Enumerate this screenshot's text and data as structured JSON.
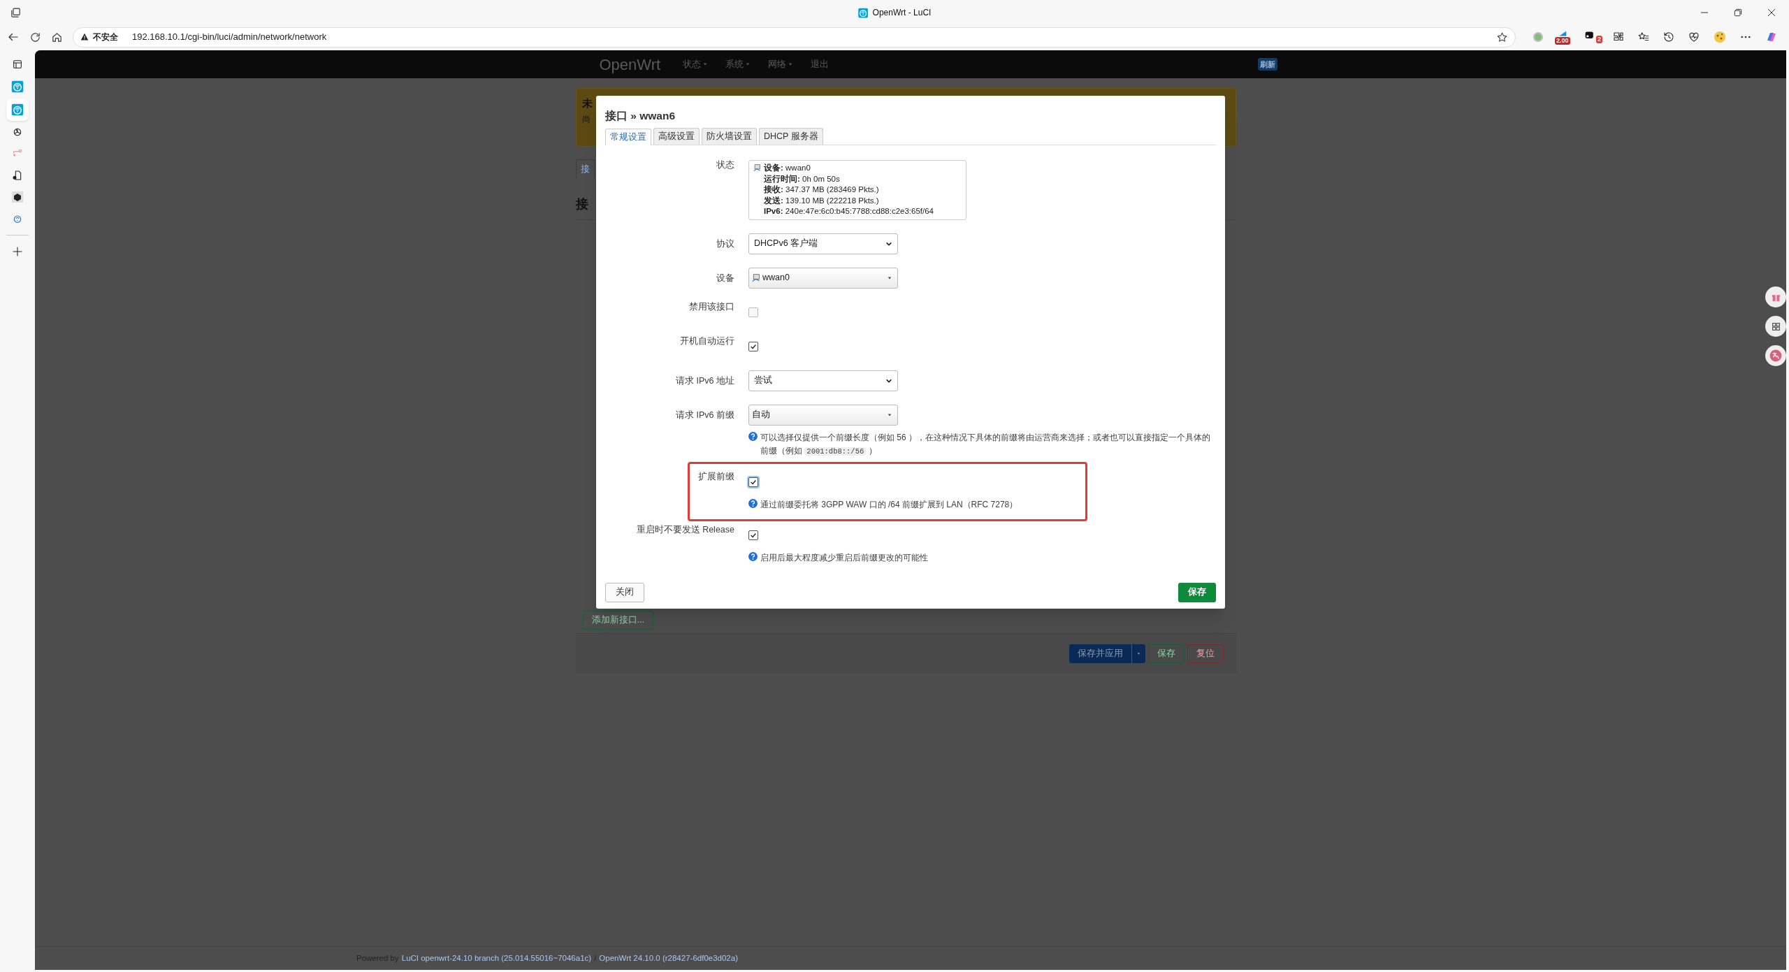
{
  "browser": {
    "tab_title": "OpenWrt - LuCI",
    "security": "不安全",
    "url": "192.168.10.1/cgi-bin/luci/admin/network/network",
    "extension_badges": [
      "2.00",
      "2"
    ]
  },
  "navbar": {
    "brand": "OpenWrt",
    "menu": [
      {
        "label": "状态",
        "dropdown": true
      },
      {
        "label": "系统",
        "dropdown": true
      },
      {
        "label": "网络",
        "dropdown": true
      },
      {
        "label": "退出",
        "dropdown": false
      }
    ],
    "badge": "刷新"
  },
  "background": {
    "alert_title": "未",
    "alert_text": "尚",
    "tab": "接",
    "heading": "接",
    "add_button": "添加新接口...",
    "actions": [
      {
        "label": "保存并应用",
        "kind": "split"
      },
      {
        "label": "保存",
        "kind": "success"
      },
      {
        "label": "复位",
        "kind": "danger"
      }
    ]
  },
  "footer": {
    "prefix": "Powered by",
    "luci": "LuCI openwrt-24.10 branch (25.014.55016~7046a1c)",
    "separator": "/",
    "openwrt": "OpenWrt 24.10.0 (r28427-6df0e3d02a)"
  },
  "dialog": {
    "title": "接口 » wwan6",
    "tabs": [
      {
        "label": "常规设置",
        "selected": true
      },
      {
        "label": "高级设置",
        "selected": false
      },
      {
        "label": "防火墙设置",
        "selected": false
      },
      {
        "label": "DHCP 服务器",
        "selected": false
      }
    ],
    "fields": [
      {
        "kind": "status",
        "label": "状态",
        "lines": [
          "**设备:** wwan0",
          "**运行时间:** 0h 0m 50s",
          "**接收:** 347.37 MB (283469 Pkts.)",
          "**发送:** 139.10 MB (222218 Pkts.)",
          "**IPv6:** 240e:47e:6c0:b45:7788:cd88:c2e3:65f/64"
        ]
      },
      {
        "kind": "select",
        "label": "协议",
        "value": "DHCPv6 客户端"
      },
      {
        "kind": "dropdown",
        "label": "设备",
        "value": "wwan0",
        "device_icon": true
      },
      {
        "kind": "checkbox",
        "label": "禁用该接口",
        "checked": false
      },
      {
        "kind": "checkbox",
        "label": "开机自动运行",
        "checked": true
      },
      {
        "kind": "select",
        "label": "请求 IPv6 地址",
        "value": "尝试"
      },
      {
        "kind": "dropdown",
        "label": "请求 IPv6 前缀",
        "value": "自动",
        "help": "可以选择仅提供一个前缀长度（例如 56 ），在这种情况下具体的前缀将由运营商来选择；或者也可以直接指定一个具体的前缀（例如 ",
        "help_code": "2001:db8::/56",
        "help_suffix": " ）"
      },
      {
        "kind": "checkbox",
        "label": "扩展前缀",
        "checked": true,
        "focused": true,
        "highlighted": true,
        "help": "通过前缀委托将 3GPP WAW 口的 /64 前缀扩展到 LAN（RFC 7278）"
      },
      {
        "kind": "checkbox",
        "label": "重启时不要发送 Release",
        "checked": true,
        "help": "启用后最大程度减少重启后前缀更改的可能性"
      }
    ],
    "close": "关闭",
    "save": "保存"
  }
}
